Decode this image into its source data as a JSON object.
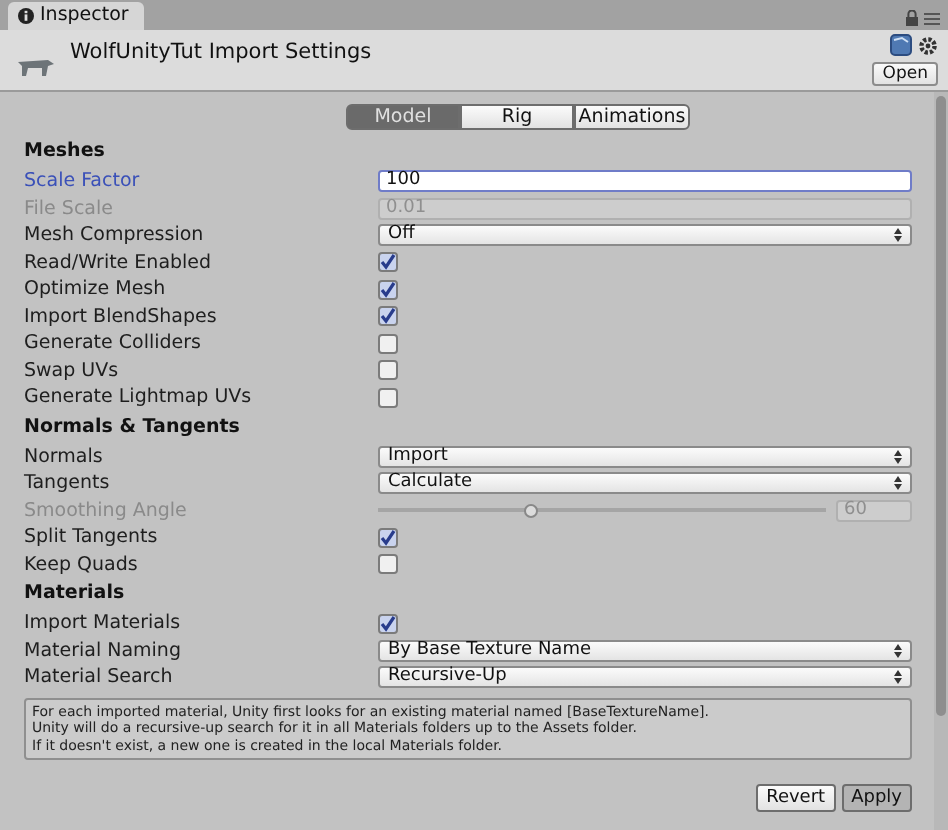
{
  "tab": {
    "label": "Inspector"
  },
  "header": {
    "title": "WolfUnityTut Import Settings",
    "open_button": "Open"
  },
  "mode_tabs": [
    {
      "label": "Model",
      "selected": true
    },
    {
      "label": "Rig",
      "selected": false
    },
    {
      "label": "Animations",
      "selected": false
    }
  ],
  "sections": [
    {
      "title": "Meshes",
      "rows": [
        {
          "kind": "field",
          "label": "Scale Factor",
          "value": "100",
          "focused": true,
          "disabled": false
        },
        {
          "kind": "field",
          "label": "File Scale",
          "value": "0.01",
          "focused": false,
          "disabled": true
        },
        {
          "kind": "dropdown",
          "label": "Mesh Compression",
          "value": "Off",
          "disabled": false
        },
        {
          "kind": "checkbox",
          "label": "Read/Write Enabled",
          "checked": true,
          "disabled": false
        },
        {
          "kind": "checkbox",
          "label": "Optimize Mesh",
          "checked": true,
          "disabled": false
        },
        {
          "kind": "checkbox",
          "label": "Import BlendShapes",
          "checked": true,
          "disabled": false
        },
        {
          "kind": "checkbox",
          "label": "Generate Colliders",
          "checked": false,
          "disabled": false
        },
        {
          "kind": "checkbox",
          "label": "Swap UVs",
          "checked": false,
          "disabled": false
        },
        {
          "kind": "checkbox",
          "label": "Generate Lightmap UVs",
          "checked": false,
          "disabled": false
        }
      ]
    },
    {
      "title": "Normals & Tangents",
      "rows": [
        {
          "kind": "dropdown",
          "label": "Normals",
          "value": "Import",
          "disabled": false
        },
        {
          "kind": "dropdown",
          "label": "Tangents",
          "value": "Calculate",
          "disabled": false
        },
        {
          "kind": "slider",
          "label": "Smoothing Angle",
          "level": 0.34,
          "value": "60",
          "disabled": true
        },
        {
          "kind": "checkbox",
          "label": "Split Tangents",
          "checked": true,
          "disabled": false
        },
        {
          "kind": "checkbox",
          "label": "Keep Quads",
          "checked": false,
          "disabled": false
        }
      ]
    },
    {
      "title": "Materials",
      "rows": [
        {
          "kind": "checkbox",
          "label": "Import Materials",
          "checked": true,
          "disabled": false
        },
        {
          "kind": "dropdown",
          "label": "Material Naming",
          "value": "By Base Texture Name",
          "disabled": false
        },
        {
          "kind": "dropdown",
          "label": "Material Search",
          "value": "Recursive-Up",
          "disabled": false
        }
      ]
    }
  ],
  "help_text": [
    "For each imported material, Unity first looks for an existing material named [BaseTextureName].",
    "Unity will do a recursive-up search for it in all Materials folders up to the Assets folder.",
    "If it doesn't exist, a new one is created in the local Materials folder."
  ],
  "buttons": [
    "Revert",
    "Apply"
  ]
}
